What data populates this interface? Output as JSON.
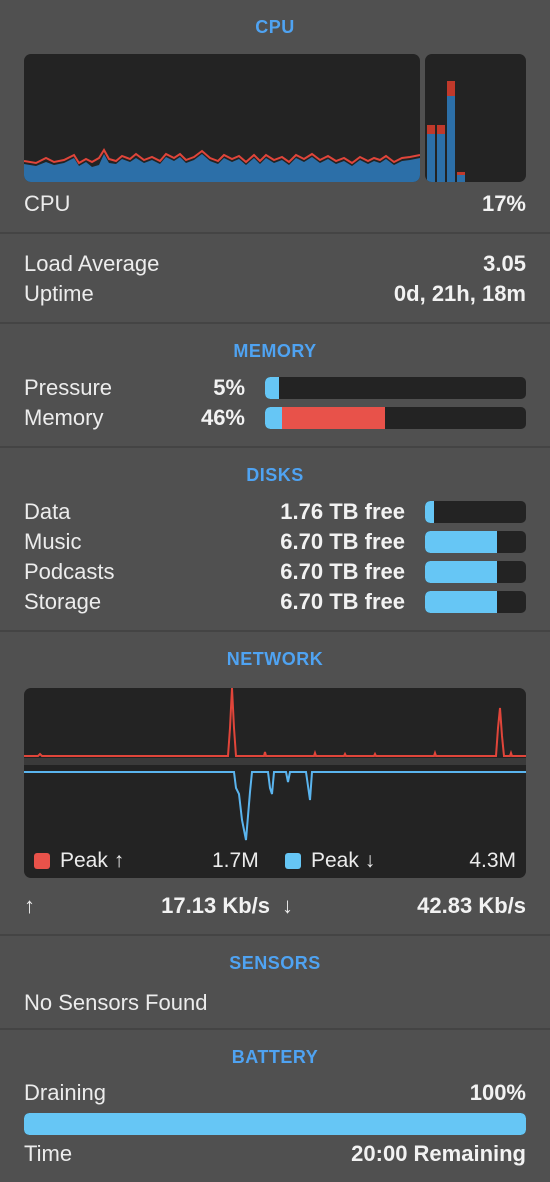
{
  "colors": {
    "accent": "#4fa3f2",
    "cpu_user": "#2c6fa8",
    "cpu_system": "#e0453a",
    "bar_blue": "#66c6f5",
    "bar_red": "#e8524a",
    "track": "#232323"
  },
  "cpu": {
    "title": "CPU",
    "label": "CPU",
    "value": "17%",
    "load_label": "Load Average",
    "load_value": "3.05",
    "uptime_label": "Uptime",
    "uptime_value": "0d, 21h, 18m",
    "per_core_usage_fraction": [
      0.45,
      0.45,
      0.8,
      0.08,
      0.0,
      0.0,
      0.0,
      0.0
    ]
  },
  "memory": {
    "title": "MEMORY",
    "pressure_label": "Pressure",
    "pressure_value": "5%",
    "pressure_fraction": 0.05,
    "memory_label": "Memory",
    "memory_value": "46%",
    "memory_fraction": 0.46
  },
  "disks": {
    "title": "DISKS",
    "items": [
      {
        "name": "Data",
        "free": "1.76 TB free",
        "used_fraction": 0.05
      },
      {
        "name": "Music",
        "free": "6.70 TB free",
        "used_fraction": 0.71
      },
      {
        "name": "Podcasts",
        "free": "6.70 TB free",
        "used_fraction": 0.71
      },
      {
        "name": "Storage",
        "free": "6.70 TB free",
        "used_fraction": 0.71
      }
    ]
  },
  "network": {
    "title": "NETWORK",
    "peak_up_label": "Peak ↑",
    "peak_up_value": "1.7M",
    "peak_down_label": "Peak ↓",
    "peak_down_value": "4.3M",
    "up_arrow": "↑",
    "up_rate": "17.13 Kb/s",
    "down_arrow": "↓",
    "down_rate": "42.83 Kb/s"
  },
  "sensors": {
    "title": "SENSORS",
    "message": "No Sensors Found"
  },
  "battery": {
    "title": "BATTERY",
    "state_label": "Draining",
    "level_value": "100%",
    "level_fraction": 1.0,
    "time_label": "Time",
    "time_value": "20:00 Remaining"
  }
}
